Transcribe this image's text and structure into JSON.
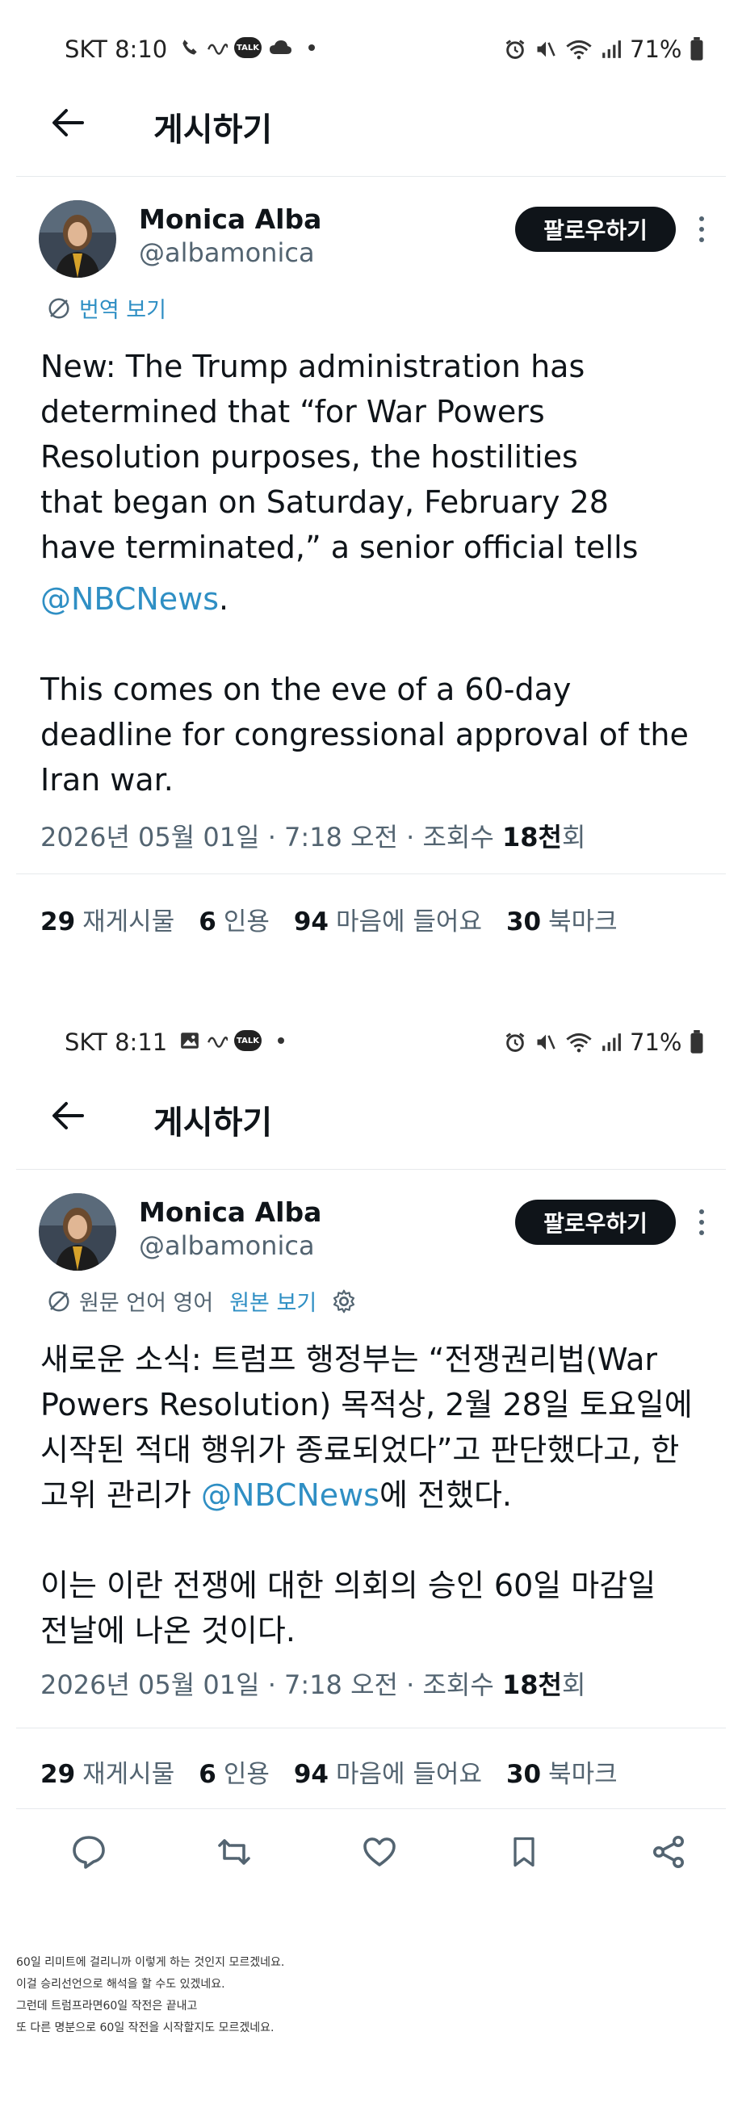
{
  "screen1": {
    "status": {
      "carrier_time": "SKT 8:10",
      "battery": "71%",
      "left_icons": [
        "call-icon",
        "wave-icon",
        "talk-icon",
        "cloud-icon"
      ]
    },
    "header": {
      "title": "게시하기"
    },
    "author": {
      "name": "Monica Alba",
      "handle": "@albamonica",
      "follow_label": "팔로우하기"
    },
    "translate_label": "번역 보기",
    "body": {
      "lines": [
        "New: The Trump administration has",
        "determined that “for War Powers",
        "Resolution purposes, the hostilities",
        "that began on Saturday, February 28",
        "have terminated,” a senior official tells"
      ],
      "mention": "@NBCNews",
      "mention_suffix": ".",
      "para2": [
        "This comes on the eve of a 60-day",
        "deadline for congressional approval of the",
        "Iran war."
      ]
    },
    "meta": {
      "date": "2026년 05월 01일 · 7:18 오전 · 조회수 ",
      "views": "18천",
      "views_suffix": "회"
    },
    "stats": [
      {
        "num": "29",
        "label": "재게시물"
      },
      {
        "num": "6",
        "label": "인용"
      },
      {
        "num": "94",
        "label": "마음에 들어요"
      },
      {
        "num": "30",
        "label": "북마크"
      }
    ]
  },
  "screen2": {
    "status": {
      "carrier_time": "SKT 8:11",
      "battery": "71%",
      "left_icons": [
        "image-icon",
        "wave-icon",
        "talk-icon"
      ]
    },
    "header": {
      "title": "게시하기"
    },
    "author": {
      "name": "Monica Alba",
      "handle": "@albamonica",
      "follow_label": "팔로우하기"
    },
    "translate": {
      "source_label": "원문 언어 영어",
      "original_label": "원본 보기"
    },
    "body": {
      "line1": "새로운 소식: 트럼프 행정부는 “전쟁권리법(War",
      "line2": "Powers Resolution) 목적상, 2월 28일 토요일에",
      "line3": "시작된 적대 행위가 종료되었다”고 판단했다고, 한",
      "line4_prefix": "고위 관리가 ",
      "mention": "@NBCNews",
      "line4_suffix": "에 전했다.",
      "para2": [
        "이는 이란 전쟁에 대한 의회의 승인 60일 마감일",
        "전날에 나온 것이다."
      ]
    },
    "meta": {
      "date": "2026년 05월 01일 · 7:18 오전 · 조회수 ",
      "views": "18천",
      "views_suffix": "회"
    },
    "stats": [
      {
        "num": "29",
        "label": "재게시물"
      },
      {
        "num": "6",
        "label": "인용"
      },
      {
        "num": "94",
        "label": "마음에 들어요"
      },
      {
        "num": "30",
        "label": "북마크"
      }
    ]
  },
  "footnote": [
    "60일 리미트에 걸리니까 이렇게 하는 것인지 모르겠네요.",
    "이걸 승리선언으로 해석을 할 수도 있겠네요.",
    "그런데 트럼프라면60일 작전은 끝내고",
    "또 다른 명분으로 60일 작전을 시작할지도 모르겠네요."
  ],
  "colors": {
    "text": "#0f1419",
    "muted": "#536471",
    "link": "#2f8fc4",
    "follow_bg": "#0f1419"
  }
}
